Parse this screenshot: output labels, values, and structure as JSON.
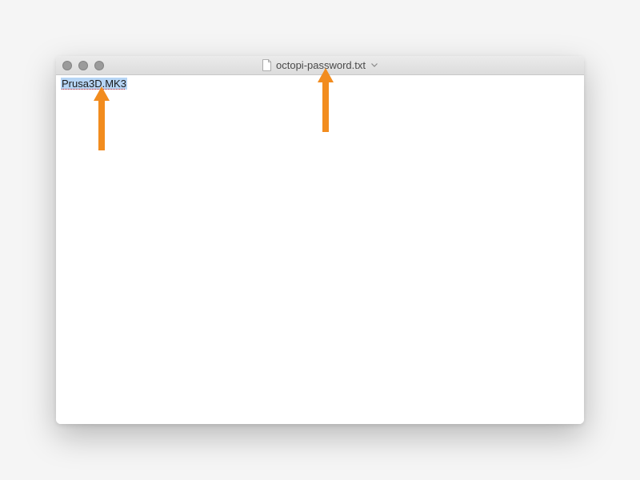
{
  "window": {
    "title": "octopi-password.txt"
  },
  "editor": {
    "content": "Prusa3D.MK3"
  },
  "annotations": {
    "arrow_color": "#f28c1e"
  }
}
